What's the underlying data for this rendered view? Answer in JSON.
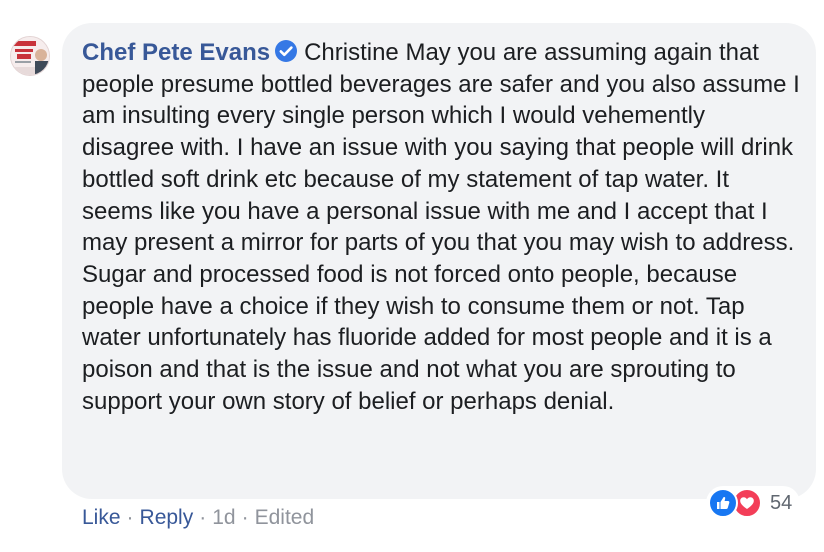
{
  "comment": {
    "author": "Chef Pete Evans",
    "author_verified": true,
    "text": "Christine May you are assuming again that people presume bottled beverages are safer and you also assume I am insulting every single person which I would vehemently disagree with. I have an issue with you saying that people will drink bottled soft drink etc because of my statement of tap water. It seems like you have a personal issue with me and I accept that I may present a mirror for parts of you that you may wish to address. Sugar and processed food is not forced onto people, because people have a choice if they wish to consume them or not. Tap water unfortunately has fluoride added for most people and it is a poison and that is the issue and not what you are sprouting to support your own story of belief or perhaps denial.",
    "avatar_icon": "profile-avatar-healthy-eats",
    "verified_icon": "verified-badge-icon"
  },
  "reactions": {
    "icons": [
      "like-icon",
      "love-icon"
    ],
    "count": "54"
  },
  "actions": {
    "like_label": "Like",
    "reply_label": "Reply",
    "time": "1d",
    "edited": "Edited"
  },
  "colors": {
    "link": "#385898",
    "meta": "#90949c",
    "bubble": "#f2f3f5",
    "like": "#1877f2",
    "love": "#f33e58"
  }
}
